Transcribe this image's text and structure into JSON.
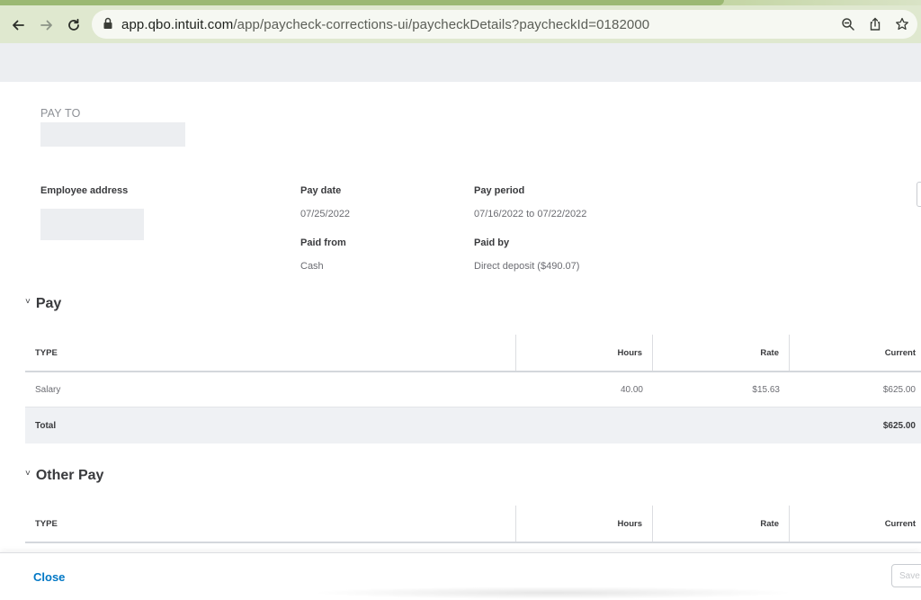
{
  "browser": {
    "url_host": "app.qbo.intuit.com",
    "url_path": "/app/paycheck-corrections-ui/paycheckDetails?paycheckId=0182000"
  },
  "paycheck": {
    "pay_to_label": "PAY TO",
    "employee_address_label": "Employee address",
    "pay_date_label": "Pay date",
    "pay_date": "07/25/2022",
    "pay_period_label": "Pay period",
    "pay_period": "07/16/2022 to 07/22/2022",
    "paid_from_label": "Paid from",
    "paid_from": "Cash",
    "paid_by_label": "Paid by",
    "paid_by": "Direct deposit ($490.07)"
  },
  "pay_section": {
    "title": "Pay",
    "columns": [
      "TYPE",
      "Hours",
      "Rate",
      "Current"
    ],
    "rows": [
      {
        "type": "Salary",
        "hours": "40.00",
        "rate": "$15.63",
        "current": "$625.00"
      }
    ],
    "total_label": "Total",
    "total_current": "$625.00"
  },
  "other_pay_section": {
    "title": "Other Pay",
    "columns": [
      "TYPE",
      "Hours",
      "Rate",
      "Current"
    ]
  },
  "footer": {
    "close_label": "Close",
    "right_button_label": "Save"
  },
  "colors": {
    "link": "#0077c5",
    "browser_toolbar": "#dfe8cf",
    "total_row_bg": "#eff1f4"
  }
}
